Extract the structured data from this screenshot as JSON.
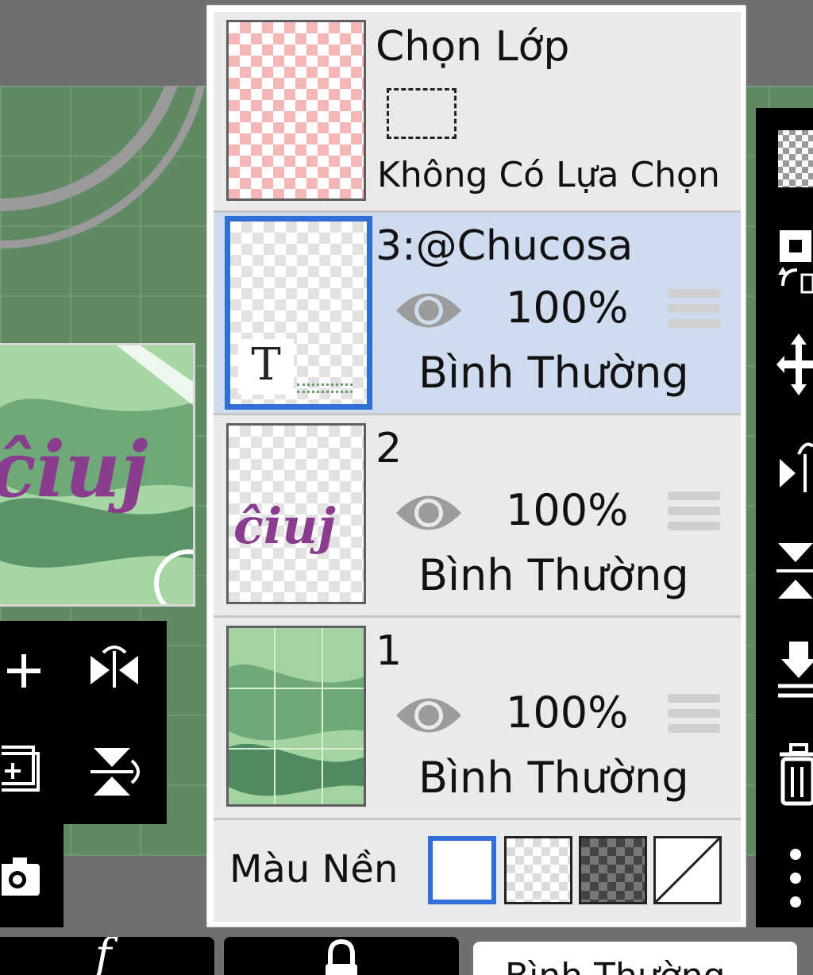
{
  "panel": {
    "selection": {
      "title": "Chọn Lớp",
      "status": "Không Có Lựa Chọn",
      "icon": "dashed-selection-icon"
    },
    "layers": [
      {
        "name": "3:@Chucosa",
        "opacity": "100%",
        "blend_mode": "Bình Thường",
        "visible": true,
        "selected": true,
        "type": "text",
        "thumb_glyph": "T"
      },
      {
        "name": "2",
        "opacity": "100%",
        "blend_mode": "Bình Thường",
        "visible": true,
        "selected": false,
        "type": "image"
      },
      {
        "name": "1",
        "opacity": "100%",
        "blend_mode": "Bình Thường",
        "visible": true,
        "selected": false,
        "type": "image"
      }
    ],
    "background": {
      "label": "Màu Nền",
      "options": [
        "white",
        "transparent-light",
        "transparent-dark",
        "none"
      ],
      "selected": "white"
    }
  },
  "bottom_bar": {
    "left_glyph": "f",
    "blend_mode_label": "Bình Thường"
  },
  "left_toolbar": {
    "icons": [
      "add-layer-icon",
      "flip-horizontal-icon",
      "add-sublayer-icon",
      "flip-vertical-icon",
      "camera-icon"
    ]
  },
  "right_toolbar": {
    "icons": [
      "checker-icon",
      "transform-layer-icon",
      "move-icon",
      "flip-layer-icon",
      "merge-icon",
      "download-icon",
      "trash-icon",
      "more-icon"
    ]
  },
  "colors": {
    "accent": "#2f6fd6",
    "selected_row": "#cfdcef",
    "row": "#eaeaea",
    "canvas_green": "#5f8a64"
  }
}
